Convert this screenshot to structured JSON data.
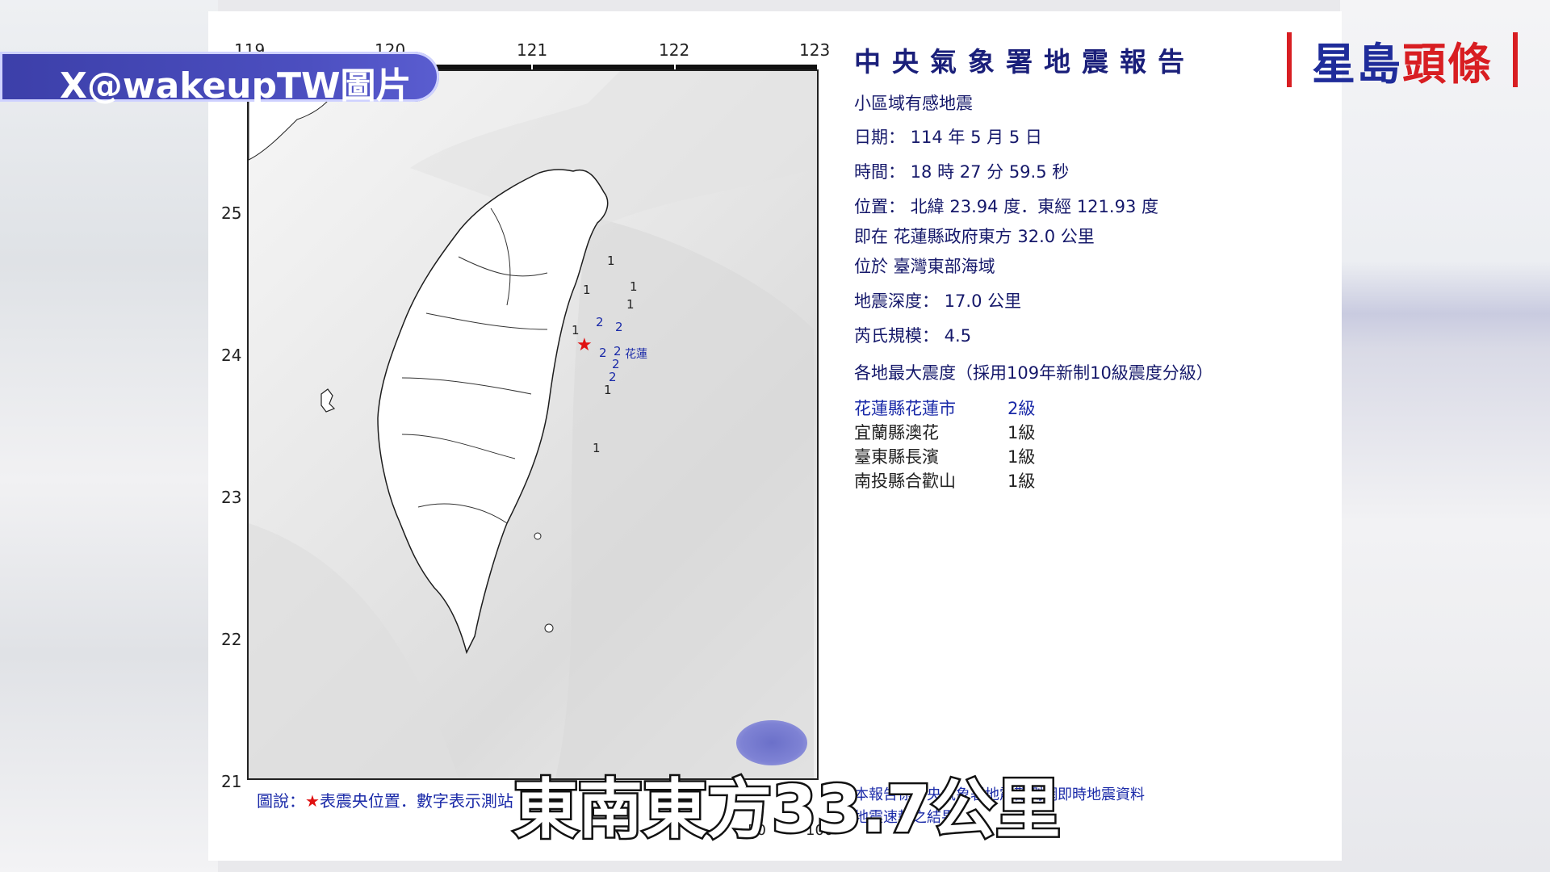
{
  "overlay": {
    "source_tag": "X@wakeupTW圖片",
    "logo_part1": "星島",
    "logo_part2": "頭條",
    "subtitle": "東南東方33.7公里"
  },
  "report": {
    "title": "中央氣象署地震報告",
    "category": "小區域有感地震",
    "date": "日期： 114 年 5 月 5 日",
    "time": "時間： 18 時 27 分 59.5 秒",
    "location": "位置： 北緯 23.94 度．東經 121.93 度",
    "relative": "即在 花蓮縣政府東方 32.0 公里",
    "region": "位於 臺灣東部海域",
    "depth": "地震深度： 17.0 公里",
    "magnitude": "芮氏規模： 4.5",
    "intensity_heading": "各地最大震度（採用109年新制10級震度分級）",
    "intensities": [
      {
        "place": "花蓮縣花蓮市",
        "level": "2級"
      },
      {
        "place": "宜蘭縣澳花",
        "level": "1級"
      },
      {
        "place": "臺東縣長濱",
        "level": "1級"
      },
      {
        "place": "南投縣合歡山",
        "level": "1級"
      }
    ],
    "footnote1": "本報告係中央氣象署地震觀測網即時地震資料",
    "footnote2": "地震速報之結果"
  },
  "map": {
    "lon_ticks": [
      "119",
      "120",
      "121",
      "122",
      "123"
    ],
    "lat_ticks": [
      "25",
      "24",
      "23",
      "22",
      "21"
    ],
    "legend": "圖說：",
    "legend_star": "★",
    "legend_rest": "表震央位置．數字表示測站",
    "scale_labels": [
      "0",
      "50",
      "100"
    ],
    "city": "花蓮",
    "station_values": [
      "1",
      "1",
      "1",
      "1",
      "2",
      "2",
      "1",
      "2",
      "2",
      "2",
      "2",
      "1",
      "1"
    ]
  },
  "colors": {
    "accent_blue": "#1a2aa8",
    "epicenter_red": "#e01010",
    "logo_red": "#d81e22",
    "logo_blue": "#1f2c9a"
  }
}
